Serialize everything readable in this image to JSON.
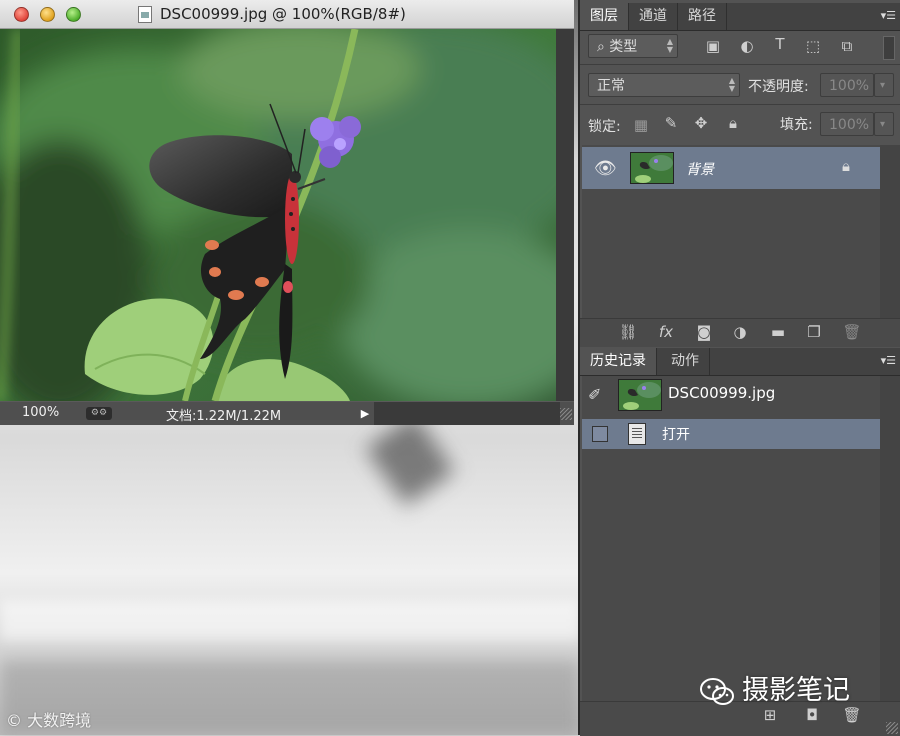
{
  "document": {
    "title": "DSC00999.jpg @ 100%(RGB/8#)",
    "zoom": "100%",
    "doc_size": "文档:1.22M/1.22M"
  },
  "layers_panel": {
    "tabs": [
      "图层",
      "通道",
      "路径"
    ],
    "active_tab": "图层",
    "filter_label": "类型",
    "blend_mode": "正常",
    "opacity_label": "不透明度:",
    "opacity_value": "100%",
    "lock_label": "锁定:",
    "fill_label": "填充:",
    "fill_value": "100%",
    "layers": [
      {
        "name": "背景",
        "visible": true,
        "locked": true,
        "selected": true
      }
    ]
  },
  "history_panel": {
    "tabs": [
      "历史记录",
      "动作"
    ],
    "active_tab": "历史记录",
    "snapshot": "DSC00999.jpg",
    "states": [
      {
        "name": "打开",
        "selected": true
      }
    ]
  },
  "watermarks": {
    "left": "大数跨境",
    "right": "摄影笔记"
  },
  "colors": {
    "panel_bg": "#535353",
    "selection": "#6e7b8f",
    "titlebar": "#e0e0e0"
  }
}
